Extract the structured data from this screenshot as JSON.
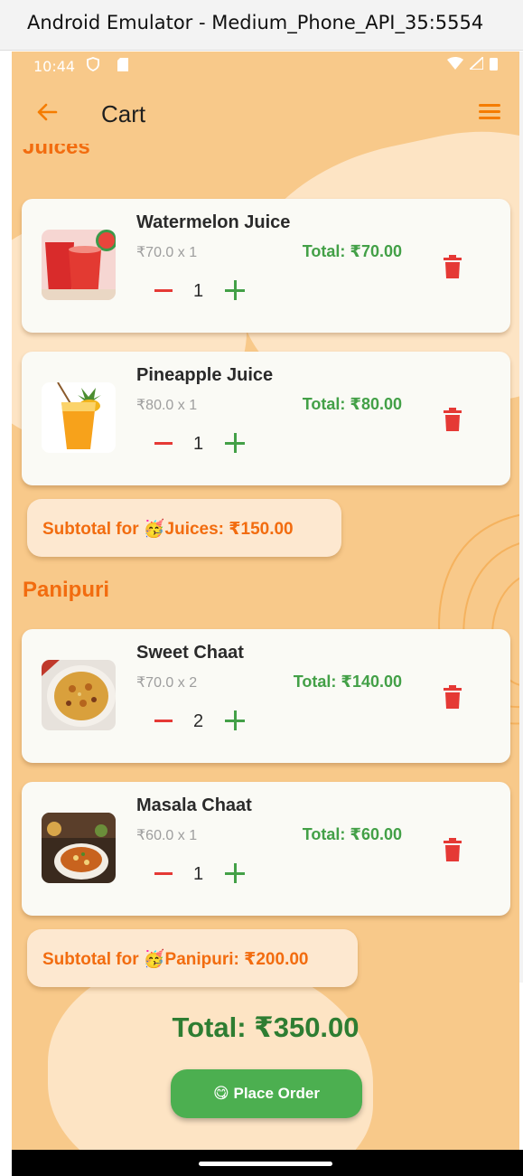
{
  "window": {
    "title": "Android Emulator - Medium_Phone_API_35:5554"
  },
  "status_bar": {
    "time": "10:44"
  },
  "app_bar": {
    "title": "Cart"
  },
  "icons": {
    "back": "arrow-left-icon",
    "menu": "hamburger-menu-icon",
    "delete": "trash-icon",
    "minus": "minus-icon",
    "plus": "plus-icon"
  },
  "colors": {
    "accent": "#f57c00",
    "background": "#f8c98a",
    "total_green": "#43a047",
    "delete_red": "#e53935",
    "button_green": "#4caf50"
  },
  "sections": [
    {
      "title": "Juices",
      "items": [
        {
          "name": "Watermelon Juice",
          "price_line": "₹70.0 x 1",
          "total": "Total: ₹70.00",
          "quantity": "1"
        },
        {
          "name": "Pineapple Juice",
          "price_line": "₹80.0 x 1",
          "total": "Total: ₹80.00",
          "quantity": "1"
        }
      ],
      "subtotal": "Subtotal for 🥳Juices: ₹150.00"
    },
    {
      "title": "Panipuri",
      "items": [
        {
          "name": "Sweet Chaat",
          "price_line": "₹70.0 x 2",
          "total": "Total: ₹140.00",
          "quantity": "2"
        },
        {
          "name": "Masala Chaat",
          "price_line": "₹60.0 x 1",
          "total": "Total: ₹60.00",
          "quantity": "1"
        }
      ],
      "subtotal": "Subtotal for 🥳Panipuri: ₹200.00"
    }
  ],
  "grand_total": "Total: ₹350.00",
  "place_order_label": "😋 Place Order"
}
